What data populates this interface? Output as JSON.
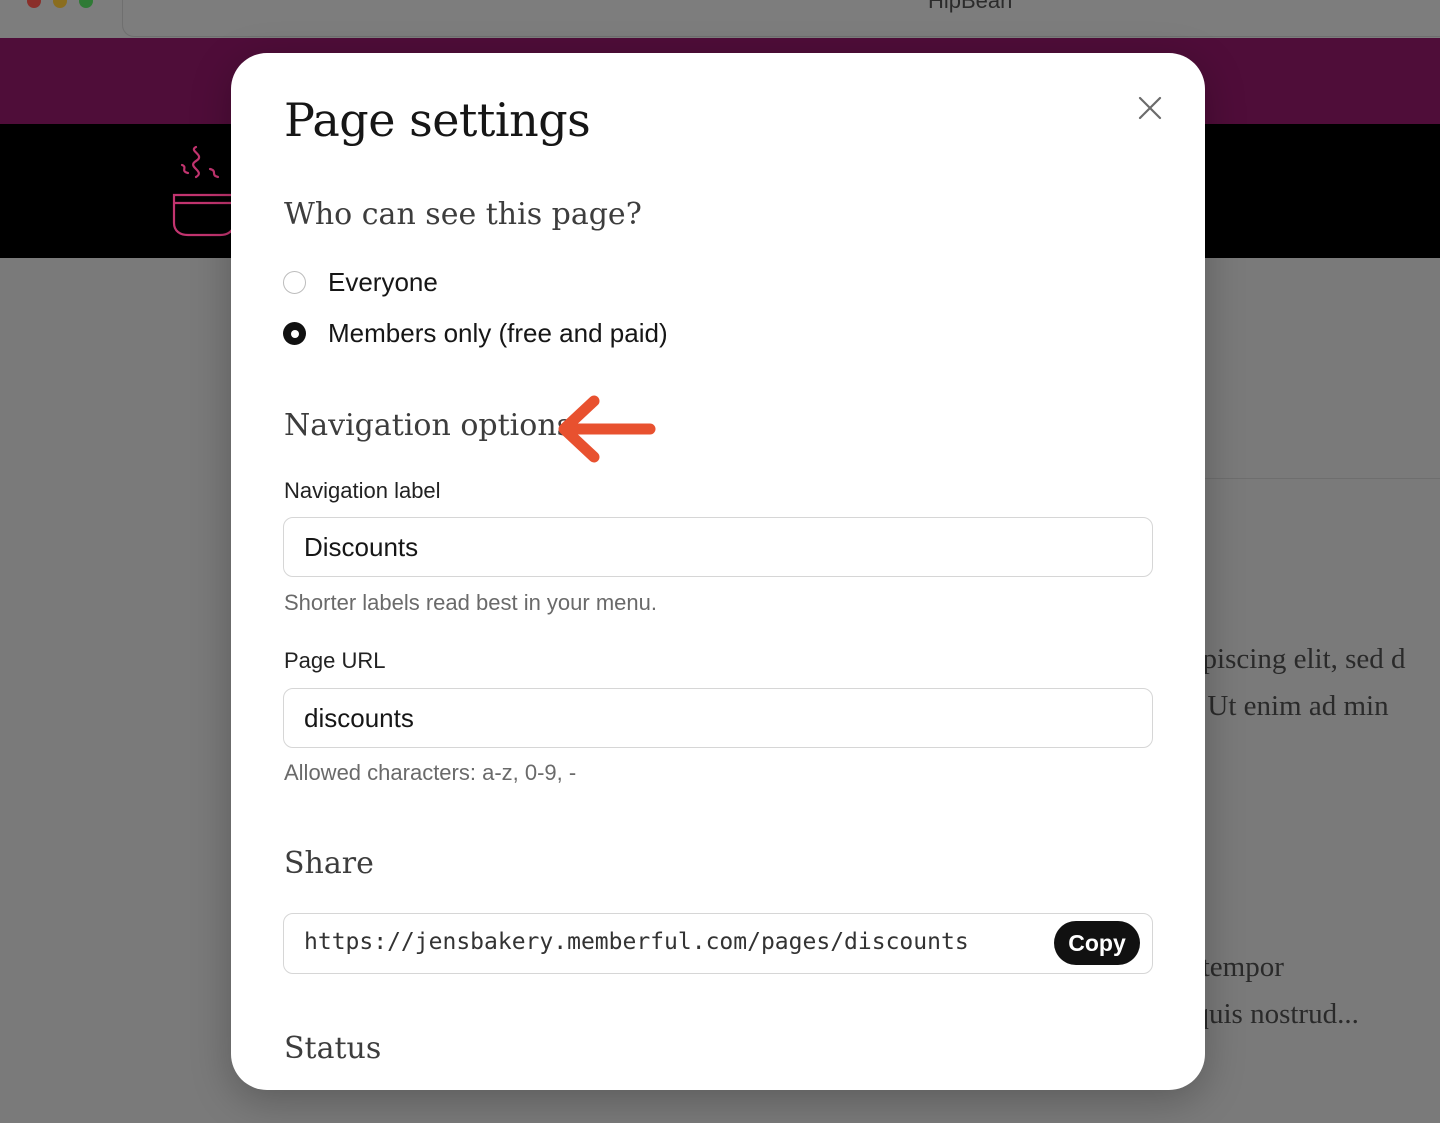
{
  "window": {
    "title": "HipBean"
  },
  "background": {
    "text_lines": [
      "dipiscing elit, sed d",
      "a. Ut enim ad min",
      "d tempor",
      ", quis nostrud..."
    ]
  },
  "modal": {
    "title": "Page settings",
    "visibility": {
      "heading": "Who can see this page?",
      "options": [
        {
          "label": "Everyone",
          "selected": false
        },
        {
          "label": "Members only (free and paid)",
          "selected": true
        }
      ]
    },
    "navigation": {
      "heading": "Navigation options",
      "label_field": {
        "label": "Navigation label",
        "value": "Discounts",
        "hint": "Shorter labels read best in your menu."
      },
      "url_field": {
        "label": "Page URL",
        "value": "discounts",
        "hint": "Allowed characters: a-z, 0-9, -"
      }
    },
    "share": {
      "heading": "Share",
      "url": "https://jensbakery.memberful.com/pages/discounts",
      "copy_label": "Copy"
    },
    "status": {
      "heading": "Status"
    }
  },
  "colors": {
    "overlay": "#7a7a7a",
    "promo_bar": "#4f0d39",
    "header": "#000000",
    "annotation_arrow": "#e8512f",
    "logo_stroke": "#c2346f",
    "primary_button": "#111111"
  },
  "icons": {
    "close": "close-icon",
    "logo": "coffee-cup-icon",
    "annotation": "arrow-left-icon"
  }
}
